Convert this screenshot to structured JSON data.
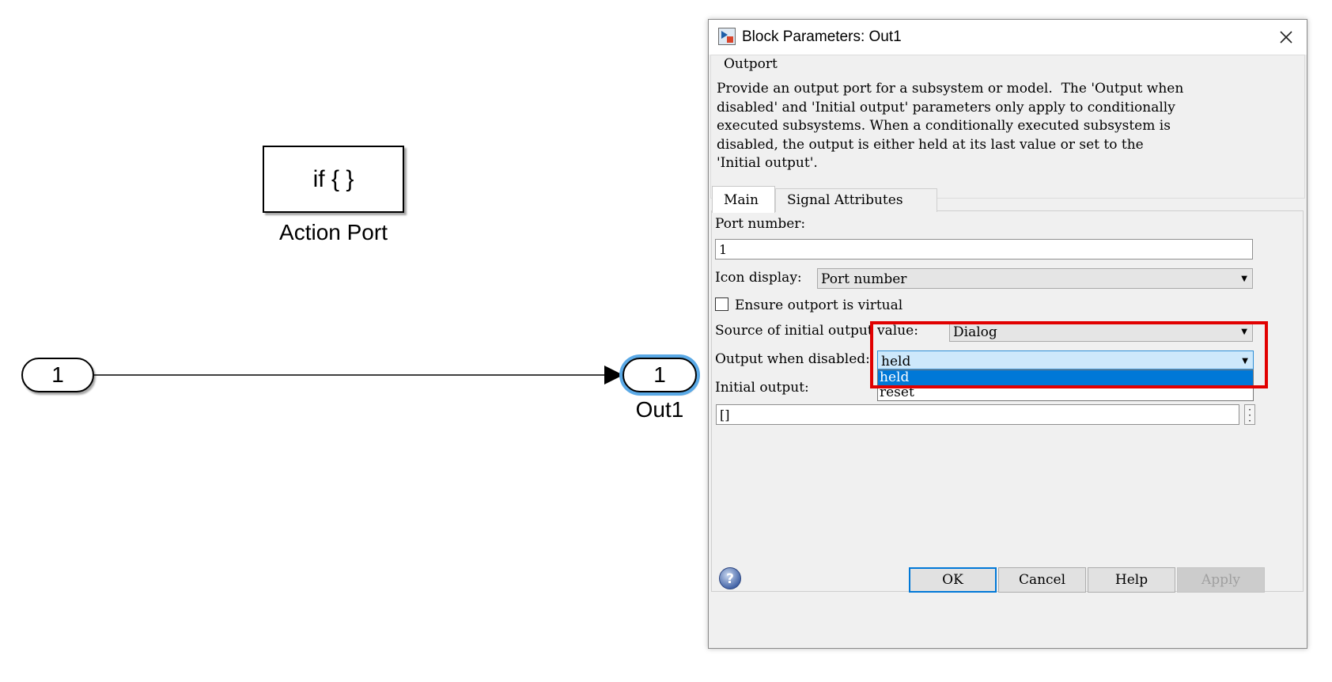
{
  "canvas": {
    "action_block_text": "if { }",
    "action_block_label": "Action Port",
    "inport_number": "1",
    "outport_number": "1",
    "outport_label": "Out1"
  },
  "dialog": {
    "title": "Block Parameters: Out1",
    "group_title": "Outport",
    "description": "Provide an output port for a subsystem or model.  The 'Output when\ndisabled' and 'Initial output' parameters only apply to conditionally\nexecuted subsystems. When a conditionally executed subsystem is\ndisabled, the output is either held at its last value or set to the\n'Initial output'.",
    "tabs": [
      {
        "label": "Main",
        "active": true
      },
      {
        "label": "Signal Attributes",
        "active": false
      }
    ],
    "port_number_label": "Port number:",
    "port_number_value": "1",
    "icon_display_label": "Icon display:",
    "icon_display_value": "Port number",
    "ensure_virtual_label": "Ensure outport is virtual",
    "ensure_virtual_checked": false,
    "source_initial_label": "Source of initial output value:",
    "source_initial_value": "Dialog",
    "output_disabled_label": "Output when disabled:",
    "output_disabled_value": "held",
    "output_disabled_options": [
      "held",
      "reset"
    ],
    "initial_output_label": "Initial output:",
    "initial_output_value": "[]",
    "buttons": {
      "ok": "OK",
      "cancel": "Cancel",
      "help": "Help",
      "apply": "Apply"
    }
  },
  "colors": {
    "highlight": "#e10000",
    "selection": "#0078d7",
    "port_selected_glow": "#5aa9e6"
  }
}
